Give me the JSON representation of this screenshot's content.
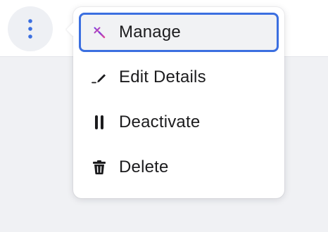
{
  "toolbar": {
    "more_icon": "kebab-vertical-icon",
    "accent_color": "#3b6fe0"
  },
  "menu": {
    "items": [
      {
        "label": "Manage",
        "icon": "magic-wand-icon",
        "active": true
      },
      {
        "label": "Edit Details",
        "icon": "pencil-icon",
        "active": false
      },
      {
        "label": "Deactivate",
        "icon": "pause-icon",
        "active": false
      },
      {
        "label": "Delete",
        "icon": "trash-icon",
        "active": false
      }
    ]
  }
}
